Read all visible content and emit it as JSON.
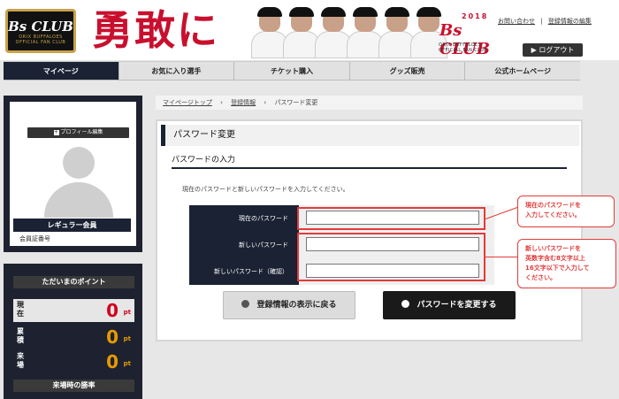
{
  "header": {
    "logo_text": "Bs CLUB",
    "logo_sub": "ORIX BUFFALOES OFFICIAL FAN CLUB",
    "slogan": "勇敢に",
    "year": "2018",
    "brand": "Bs CLUB",
    "brand_sub": "ORIX BUFFALOES OFFICIAL FAN CLUB",
    "links": [
      "お問い合わせ",
      "登録情報の編集"
    ],
    "logout_label": "ログアウト"
  },
  "nav": [
    "マイページ",
    "お気に入り選手",
    "チケット購入",
    "グッズ販売",
    "公式ホームページ"
  ],
  "profile": {
    "edit_label": "プロフィール編集",
    "grade": "レギュラー会員",
    "member_no_label": "会員証番号"
  },
  "points": {
    "title": "ただいまのポイント",
    "rows": [
      {
        "label": "現在",
        "value": "0",
        "unit": "pt"
      },
      {
        "label": "累積",
        "value": "0",
        "unit": "pt"
      },
      {
        "label": "来場",
        "value": "0",
        "unit": "pt"
      }
    ],
    "win_rate_label": "来場時の勝率"
  },
  "breadcrumb": [
    "マイページトップ",
    "登録情報",
    "パスワード変更"
  ],
  "main": {
    "title": "パスワード変更",
    "section": "パスワードの入力",
    "description": "現在のパスワードと新しいパスワードを入力してください。",
    "fields": [
      {
        "label": "現在のパスワード",
        "value": ""
      },
      {
        "label": "新しいパスワード",
        "value": ""
      },
      {
        "label": "新しいパスワード（確認）",
        "value": ""
      }
    ],
    "back_label": "登録情報の表示に戻る",
    "submit_label": "パスワードを変更する"
  },
  "callouts": {
    "current": "現在のパスワードを\n入力してください。",
    "new": "新しいパスワードを\n英数字含む8文字以上\n16文字以下で入力して\nください。"
  },
  "colors": {
    "navy": "#1a2233",
    "accent_red": "#c8102e",
    "callout_red": "#e23b3b",
    "points_orange": "#e79b00"
  }
}
